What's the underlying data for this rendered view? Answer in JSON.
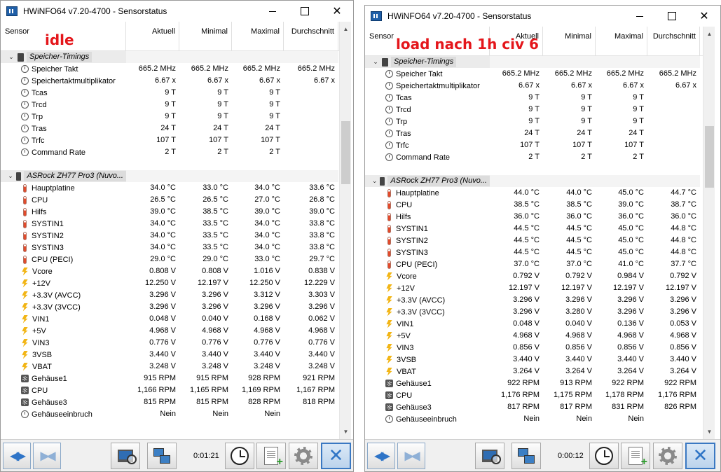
{
  "windows": [
    {
      "title": "HWiNFO64 v7.20-4700 - Sensorstatus",
      "overlay": "idle",
      "timer": "0:01:21",
      "columns": [
        "Sensor",
        "Aktuell",
        "Minimal",
        "Maximal",
        "Durchschnitt"
      ],
      "groups": [
        {
          "label": "Speicher-Timings",
          "rows": [
            {
              "icon": "clock",
              "name": "Speicher Takt",
              "v": [
                "665.2 MHz",
                "665.2 MHz",
                "665.2 MHz",
                "665.2 MHz"
              ]
            },
            {
              "icon": "clock",
              "name": "Speichertaktmultiplikator",
              "v": [
                "6.67 x",
                "6.67 x",
                "6.67 x",
                "6.67 x"
              ]
            },
            {
              "icon": "clock",
              "name": "Tcas",
              "v": [
                "9 T",
                "9 T",
                "9 T",
                ""
              ]
            },
            {
              "icon": "clock",
              "name": "Trcd",
              "v": [
                "9 T",
                "9 T",
                "9 T",
                ""
              ]
            },
            {
              "icon": "clock",
              "name": "Trp",
              "v": [
                "9 T",
                "9 T",
                "9 T",
                ""
              ]
            },
            {
              "icon": "clock",
              "name": "Tras",
              "v": [
                "24 T",
                "24 T",
                "24 T",
                ""
              ]
            },
            {
              "icon": "clock",
              "name": "Trfc",
              "v": [
                "107 T",
                "107 T",
                "107 T",
                ""
              ]
            },
            {
              "icon": "clock",
              "name": "Command Rate",
              "v": [
                "2 T",
                "2 T",
                "2 T",
                ""
              ]
            }
          ]
        },
        {
          "label": "ASRock ZH77 Pro3 (Nuvo...",
          "rows": [
            {
              "icon": "therm",
              "name": "Hauptplatine",
              "v": [
                "34.0 °C",
                "33.0 °C",
                "34.0 °C",
                "33.6 °C"
              ]
            },
            {
              "icon": "therm",
              "name": "CPU",
              "v": [
                "26.5 °C",
                "26.5 °C",
                "27.0 °C",
                "26.8 °C"
              ]
            },
            {
              "icon": "therm",
              "name": "Hilfs",
              "v": [
                "39.0 °C",
                "38.5 °C",
                "39.0 °C",
                "39.0 °C"
              ]
            },
            {
              "icon": "therm",
              "name": "SYSTIN1",
              "v": [
                "34.0 °C",
                "33.5 °C",
                "34.0 °C",
                "33.8 °C"
              ]
            },
            {
              "icon": "therm",
              "name": "SYSTIN2",
              "v": [
                "34.0 °C",
                "33.5 °C",
                "34.0 °C",
                "33.8 °C"
              ]
            },
            {
              "icon": "therm",
              "name": "SYSTIN3",
              "v": [
                "34.0 °C",
                "33.5 °C",
                "34.0 °C",
                "33.8 °C"
              ]
            },
            {
              "icon": "therm",
              "name": "CPU (PECI)",
              "v": [
                "29.0 °C",
                "29.0 °C",
                "33.0 °C",
                "29.7 °C"
              ]
            },
            {
              "icon": "volt",
              "name": "Vcore",
              "v": [
                "0.808 V",
                "0.808 V",
                "1.016 V",
                "0.838 V"
              ]
            },
            {
              "icon": "volt",
              "name": "+12V",
              "v": [
                "12.250 V",
                "12.197 V",
                "12.250 V",
                "12.229 V"
              ]
            },
            {
              "icon": "volt",
              "name": "+3.3V (AVCC)",
              "v": [
                "3.296 V",
                "3.296 V",
                "3.312 V",
                "3.303 V"
              ]
            },
            {
              "icon": "volt",
              "name": "+3.3V (3VCC)",
              "v": [
                "3.296 V",
                "3.296 V",
                "3.296 V",
                "3.296 V"
              ]
            },
            {
              "icon": "volt",
              "name": "VIN1",
              "v": [
                "0.048 V",
                "0.040 V",
                "0.168 V",
                "0.062 V"
              ]
            },
            {
              "icon": "volt",
              "name": "+5V",
              "v": [
                "4.968 V",
                "4.968 V",
                "4.968 V",
                "4.968 V"
              ]
            },
            {
              "icon": "volt",
              "name": "VIN3",
              "v": [
                "0.776 V",
                "0.776 V",
                "0.776 V",
                "0.776 V"
              ]
            },
            {
              "icon": "volt",
              "name": "3VSB",
              "v": [
                "3.440 V",
                "3.440 V",
                "3.440 V",
                "3.440 V"
              ]
            },
            {
              "icon": "volt",
              "name": "VBAT",
              "v": [
                "3.248 V",
                "3.248 V",
                "3.248 V",
                "3.248 V"
              ]
            },
            {
              "icon": "fan",
              "name": "Gehäuse1",
              "v": [
                "915 RPM",
                "915 RPM",
                "928 RPM",
                "921 RPM"
              ]
            },
            {
              "icon": "fan",
              "name": "CPU",
              "v": [
                "1,166 RPM",
                "1,165 RPM",
                "1,169 RPM",
                "1,167 RPM"
              ]
            },
            {
              "icon": "fan",
              "name": "Gehäuse3",
              "v": [
                "815 RPM",
                "815 RPM",
                "828 RPM",
                "818 RPM"
              ]
            },
            {
              "icon": "clock",
              "name": "Gehäuseeinbruch",
              "v": [
                "Nein",
                "Nein",
                "Nein",
                ""
              ]
            }
          ]
        }
      ]
    },
    {
      "title": "HWiNFO64 v7.20-4700 - Sensorstatus",
      "overlay": "load nach 1h civ 6",
      "timer": "0:00:12",
      "columns": [
        "Sensor",
        "Aktuell",
        "Minimal",
        "Maximal",
        "Durchschnitt"
      ],
      "groups": [
        {
          "label": "Speicher-Timings",
          "rows": [
            {
              "icon": "clock",
              "name": "Speicher Takt",
              "v": [
                "665.2 MHz",
                "665.2 MHz",
                "665.2 MHz",
                "665.2 MHz"
              ]
            },
            {
              "icon": "clock",
              "name": "Speichertaktmultiplikator",
              "v": [
                "6.67 x",
                "6.67 x",
                "6.67 x",
                "6.67 x"
              ]
            },
            {
              "icon": "clock",
              "name": "Tcas",
              "v": [
                "9 T",
                "9 T",
                "9 T",
                ""
              ]
            },
            {
              "icon": "clock",
              "name": "Trcd",
              "v": [
                "9 T",
                "9 T",
                "9 T",
                ""
              ]
            },
            {
              "icon": "clock",
              "name": "Trp",
              "v": [
                "9 T",
                "9 T",
                "9 T",
                ""
              ]
            },
            {
              "icon": "clock",
              "name": "Tras",
              "v": [
                "24 T",
                "24 T",
                "24 T",
                ""
              ]
            },
            {
              "icon": "clock",
              "name": "Trfc",
              "v": [
                "107 T",
                "107 T",
                "107 T",
                ""
              ]
            },
            {
              "icon": "clock",
              "name": "Command Rate",
              "v": [
                "2 T",
                "2 T",
                "2 T",
                ""
              ]
            }
          ]
        },
        {
          "label": "ASRock ZH77 Pro3 (Nuvo...",
          "rows": [
            {
              "icon": "therm",
              "name": "Hauptplatine",
              "v": [
                "44.0 °C",
                "44.0 °C",
                "45.0 °C",
                "44.7 °C"
              ]
            },
            {
              "icon": "therm",
              "name": "CPU",
              "v": [
                "38.5 °C",
                "38.5 °C",
                "39.0 °C",
                "38.7 °C"
              ]
            },
            {
              "icon": "therm",
              "name": "Hilfs",
              "v": [
                "36.0 °C",
                "36.0 °C",
                "36.0 °C",
                "36.0 °C"
              ]
            },
            {
              "icon": "therm",
              "name": "SYSTIN1",
              "v": [
                "44.5 °C",
                "44.5 °C",
                "45.0 °C",
                "44.8 °C"
              ]
            },
            {
              "icon": "therm",
              "name": "SYSTIN2",
              "v": [
                "44.5 °C",
                "44.5 °C",
                "45.0 °C",
                "44.8 °C"
              ]
            },
            {
              "icon": "therm",
              "name": "SYSTIN3",
              "v": [
                "44.5 °C",
                "44.5 °C",
                "45.0 °C",
                "44.8 °C"
              ]
            },
            {
              "icon": "therm",
              "name": "CPU (PECI)",
              "v": [
                "37.0 °C",
                "37.0 °C",
                "41.0 °C",
                "37.7 °C"
              ]
            },
            {
              "icon": "volt",
              "name": "Vcore",
              "v": [
                "0.792 V",
                "0.792 V",
                "0.984 V",
                "0.792 V"
              ]
            },
            {
              "icon": "volt",
              "name": "+12V",
              "v": [
                "12.197 V",
                "12.197 V",
                "12.197 V",
                "12.197 V"
              ]
            },
            {
              "icon": "volt",
              "name": "+3.3V (AVCC)",
              "v": [
                "3.296 V",
                "3.296 V",
                "3.296 V",
                "3.296 V"
              ]
            },
            {
              "icon": "volt",
              "name": "+3.3V (3VCC)",
              "v": [
                "3.296 V",
                "3.280 V",
                "3.296 V",
                "3.296 V"
              ]
            },
            {
              "icon": "volt",
              "name": "VIN1",
              "v": [
                "0.048 V",
                "0.040 V",
                "0.136 V",
                "0.053 V"
              ]
            },
            {
              "icon": "volt",
              "name": "+5V",
              "v": [
                "4.968 V",
                "4.968 V",
                "4.968 V",
                "4.968 V"
              ]
            },
            {
              "icon": "volt",
              "name": "VIN3",
              "v": [
                "0.856 V",
                "0.856 V",
                "0.856 V",
                "0.856 V"
              ]
            },
            {
              "icon": "volt",
              "name": "3VSB",
              "v": [
                "3.440 V",
                "3.440 V",
                "3.440 V",
                "3.440 V"
              ]
            },
            {
              "icon": "volt",
              "name": "VBAT",
              "v": [
                "3.264 V",
                "3.264 V",
                "3.264 V",
                "3.264 V"
              ]
            },
            {
              "icon": "fan",
              "name": "Gehäuse1",
              "v": [
                "922 RPM",
                "913 RPM",
                "922 RPM",
                "922 RPM"
              ]
            },
            {
              "icon": "fan",
              "name": "CPU",
              "v": [
                "1,176 RPM",
                "1,175 RPM",
                "1,178 RPM",
                "1,176 RPM"
              ]
            },
            {
              "icon": "fan",
              "name": "Gehäuse3",
              "v": [
                "817 RPM",
                "817 RPM",
                "831 RPM",
                "826 RPM"
              ]
            },
            {
              "icon": "clock",
              "name": "Gehäuseeinbruch",
              "v": [
                "Nein",
                "Nein",
                "Nein",
                ""
              ]
            }
          ]
        }
      ]
    }
  ]
}
